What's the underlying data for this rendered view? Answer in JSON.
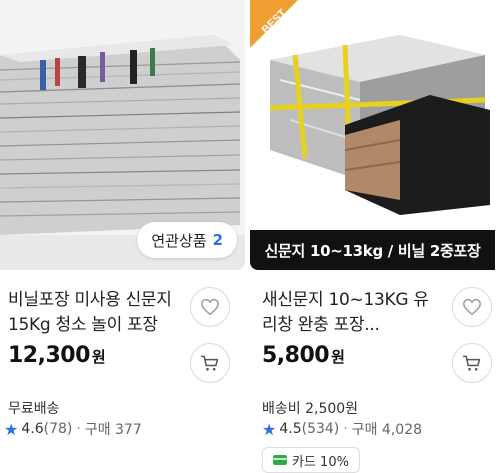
{
  "products": [
    {
      "title": "비닐포장 미사용 신문지 15Kg 청소 놀이 포장",
      "price": "12,300",
      "currency": "원",
      "shipping": "무료배송",
      "rating": "4.6",
      "reviews": "(78)",
      "purchases": "구매 377",
      "related_label": "연관상품",
      "related_count": "2"
    },
    {
      "title": "새신문지 10~13KG 유리창 완충 포장...",
      "price": "5,800",
      "currency": "원",
      "shipping": "배송비 2,500원",
      "rating": "4.5",
      "reviews": "(534)",
      "purchases": "구매 4,028",
      "image_caption": "신문지 10~13kg / 비닐 2중포장",
      "ribbon": "BEST",
      "card_benefit": "카드 10%"
    }
  ],
  "icons": {
    "heart": "heart-icon",
    "cart": "cart-icon",
    "star": "star-icon",
    "card": "credit-card-icon"
  },
  "colors": {
    "accent_blue": "#2f6fe4",
    "ribbon_orange": "#f0a033",
    "card_green": "#2ea84a"
  }
}
